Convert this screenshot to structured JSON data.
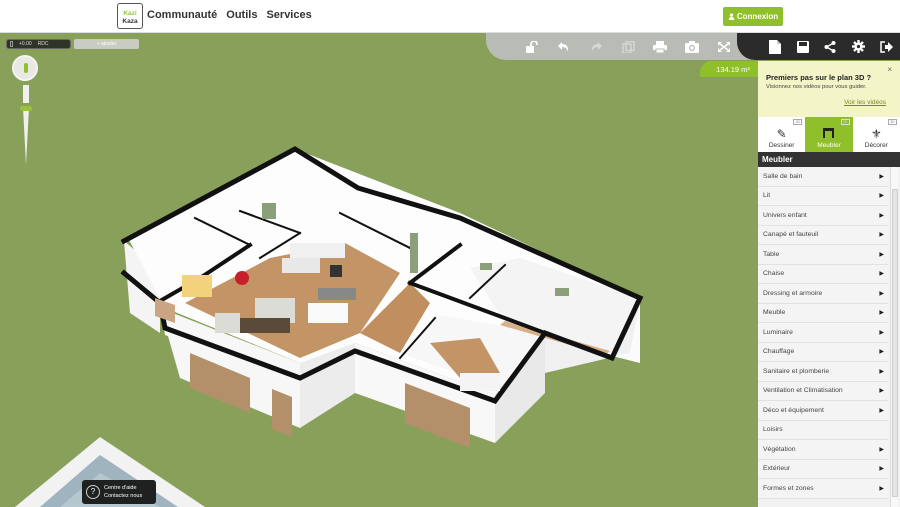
{
  "nav": {
    "logo_top": "Kazi",
    "logo_bottom": "Kaza",
    "links": [
      "Communauté",
      "Outils",
      "Services"
    ],
    "login_label": "Connexion"
  },
  "scene": {
    "level_value": "+0.00",
    "level_name": "RDC",
    "add_level_label": "+ ajouter",
    "area": "134.19 m²"
  },
  "toolbar": {
    "grey_icons": [
      "unlock-icon",
      "undo-icon",
      "redo-icon",
      "copy-icon",
      "print-icon",
      "camera-icon",
      "fullscreen-icon"
    ],
    "dark_icons": [
      "new-file-icon",
      "save-icon",
      "share-icon",
      "settings-icon",
      "logout-icon"
    ]
  },
  "help": {
    "line1": "Centre d'aide",
    "line2": "Contactez nous",
    "icon": "?"
  },
  "panel": {
    "promo_title": "Premiers pas sur le plan 3D ?",
    "promo_subtitle": "Visionnez nos vidéos pour vous guider.",
    "promo_link": "Voir les vidéos",
    "close": "×",
    "modes": [
      {
        "label": "Dessiner",
        "badge": "2D",
        "active": false
      },
      {
        "label": "Meubler",
        "badge": "3D",
        "active": true
      },
      {
        "label": "Décorer",
        "badge": "3D",
        "active": false
      }
    ],
    "section_title": "Meubler",
    "categories": [
      {
        "label": "Salle de bain",
        "arrow": true
      },
      {
        "label": "Lit",
        "arrow": true
      },
      {
        "label": "Univers enfant",
        "arrow": true
      },
      {
        "label": "Canapé et fauteuil",
        "arrow": true
      },
      {
        "label": "Table",
        "arrow": true
      },
      {
        "label": "Chaise",
        "arrow": true
      },
      {
        "label": "Dressing et armoire",
        "arrow": true
      },
      {
        "label": "Meuble",
        "arrow": true
      },
      {
        "label": "Luminaire",
        "arrow": true
      },
      {
        "label": "Chauffage",
        "arrow": true
      },
      {
        "label": "Sanitaire et plomberie",
        "arrow": true
      },
      {
        "label": "Ventilation et Climatisation",
        "arrow": true
      },
      {
        "label": "Déco et équipement",
        "arrow": true
      },
      {
        "label": "Loisirs",
        "arrow": false
      },
      {
        "label": "Végétation",
        "arrow": true
      },
      {
        "label": "Extérieur",
        "arrow": true
      },
      {
        "label": "Formes et zones",
        "arrow": true
      }
    ]
  },
  "colors": {
    "accent": "#8fbf2a",
    "grass": "#88a05a",
    "dark": "#2b2b2b",
    "promo_bg": "#f3f4c8"
  }
}
